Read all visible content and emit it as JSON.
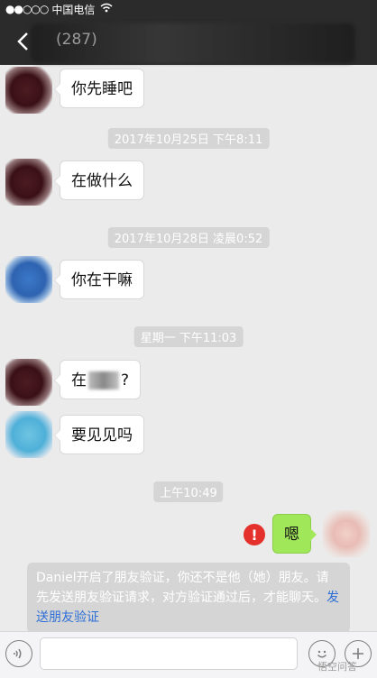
{
  "status_bar": {
    "signal": "●●○○○",
    "carrier": "中国电信",
    "wifi_icon": "wifi-icon"
  },
  "nav": {
    "back_icon": "chevron-left-icon",
    "title": "(287)"
  },
  "messages": [
    {
      "side": "left",
      "avatar": "dark",
      "text": "你先睡吧"
    },
    {
      "time": "2017年10月25日 下午8:11"
    },
    {
      "side": "left",
      "avatar": "dark",
      "text": "在做什么"
    },
    {
      "time": "2017年10月28日 凌晨0:52"
    },
    {
      "side": "left",
      "avatar": "blue",
      "text": "你在干嘛"
    },
    {
      "time": "星期一 下午11:03"
    },
    {
      "side": "left",
      "avatar": "dark",
      "text_prefix": "在",
      "text_suffix": "?"
    },
    {
      "side": "left",
      "avatar": "sky",
      "text": "要见见吗"
    },
    {
      "time": "上午10:49"
    },
    {
      "side": "right",
      "avatar": "self",
      "text": "嗯",
      "failed": true,
      "error_mark": "!"
    }
  ],
  "system_note": {
    "text": "Daniel开启了朋友验证，你还不是他（她）朋友。请先发送朋友验证请求，对方验证通过后，才能聊天。",
    "link": "发送朋友验证"
  },
  "input_bar": {
    "voice_icon": "voice-icon",
    "emoji_icon": "emoji-icon",
    "add_icon": "plus-icon",
    "input_value": ""
  },
  "watermark": "悟空问答",
  "colors": {
    "nav_bg": "#2b2b2b",
    "chat_bg": "#ebebeb",
    "self_bubble": "#a0e75a",
    "error": "#e4312b",
    "link": "#2d6fd6"
  }
}
